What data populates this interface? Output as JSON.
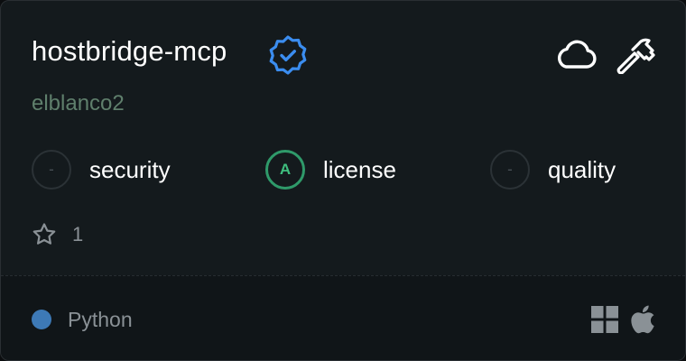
{
  "server": {
    "name": "hostbridge-mcp",
    "author": "elblanco2"
  },
  "header_icons": {
    "verified": "verified-badge-icon",
    "cloud": "cloud-icon",
    "tools": "hammer-icon"
  },
  "metrics": [
    {
      "label": "security",
      "grade": "-"
    },
    {
      "label": "license",
      "grade": "A"
    },
    {
      "label": "quality",
      "grade": "-"
    }
  ],
  "stars": {
    "count": "1"
  },
  "footer": {
    "language": "Python",
    "language_color": "#3d79b6",
    "platforms": [
      "windows-icon",
      "apple-icon"
    ]
  },
  "colors": {
    "accent_blue": "#3b8df0",
    "grade_a_green": "#2f9a6a",
    "background": "#141a1d"
  }
}
